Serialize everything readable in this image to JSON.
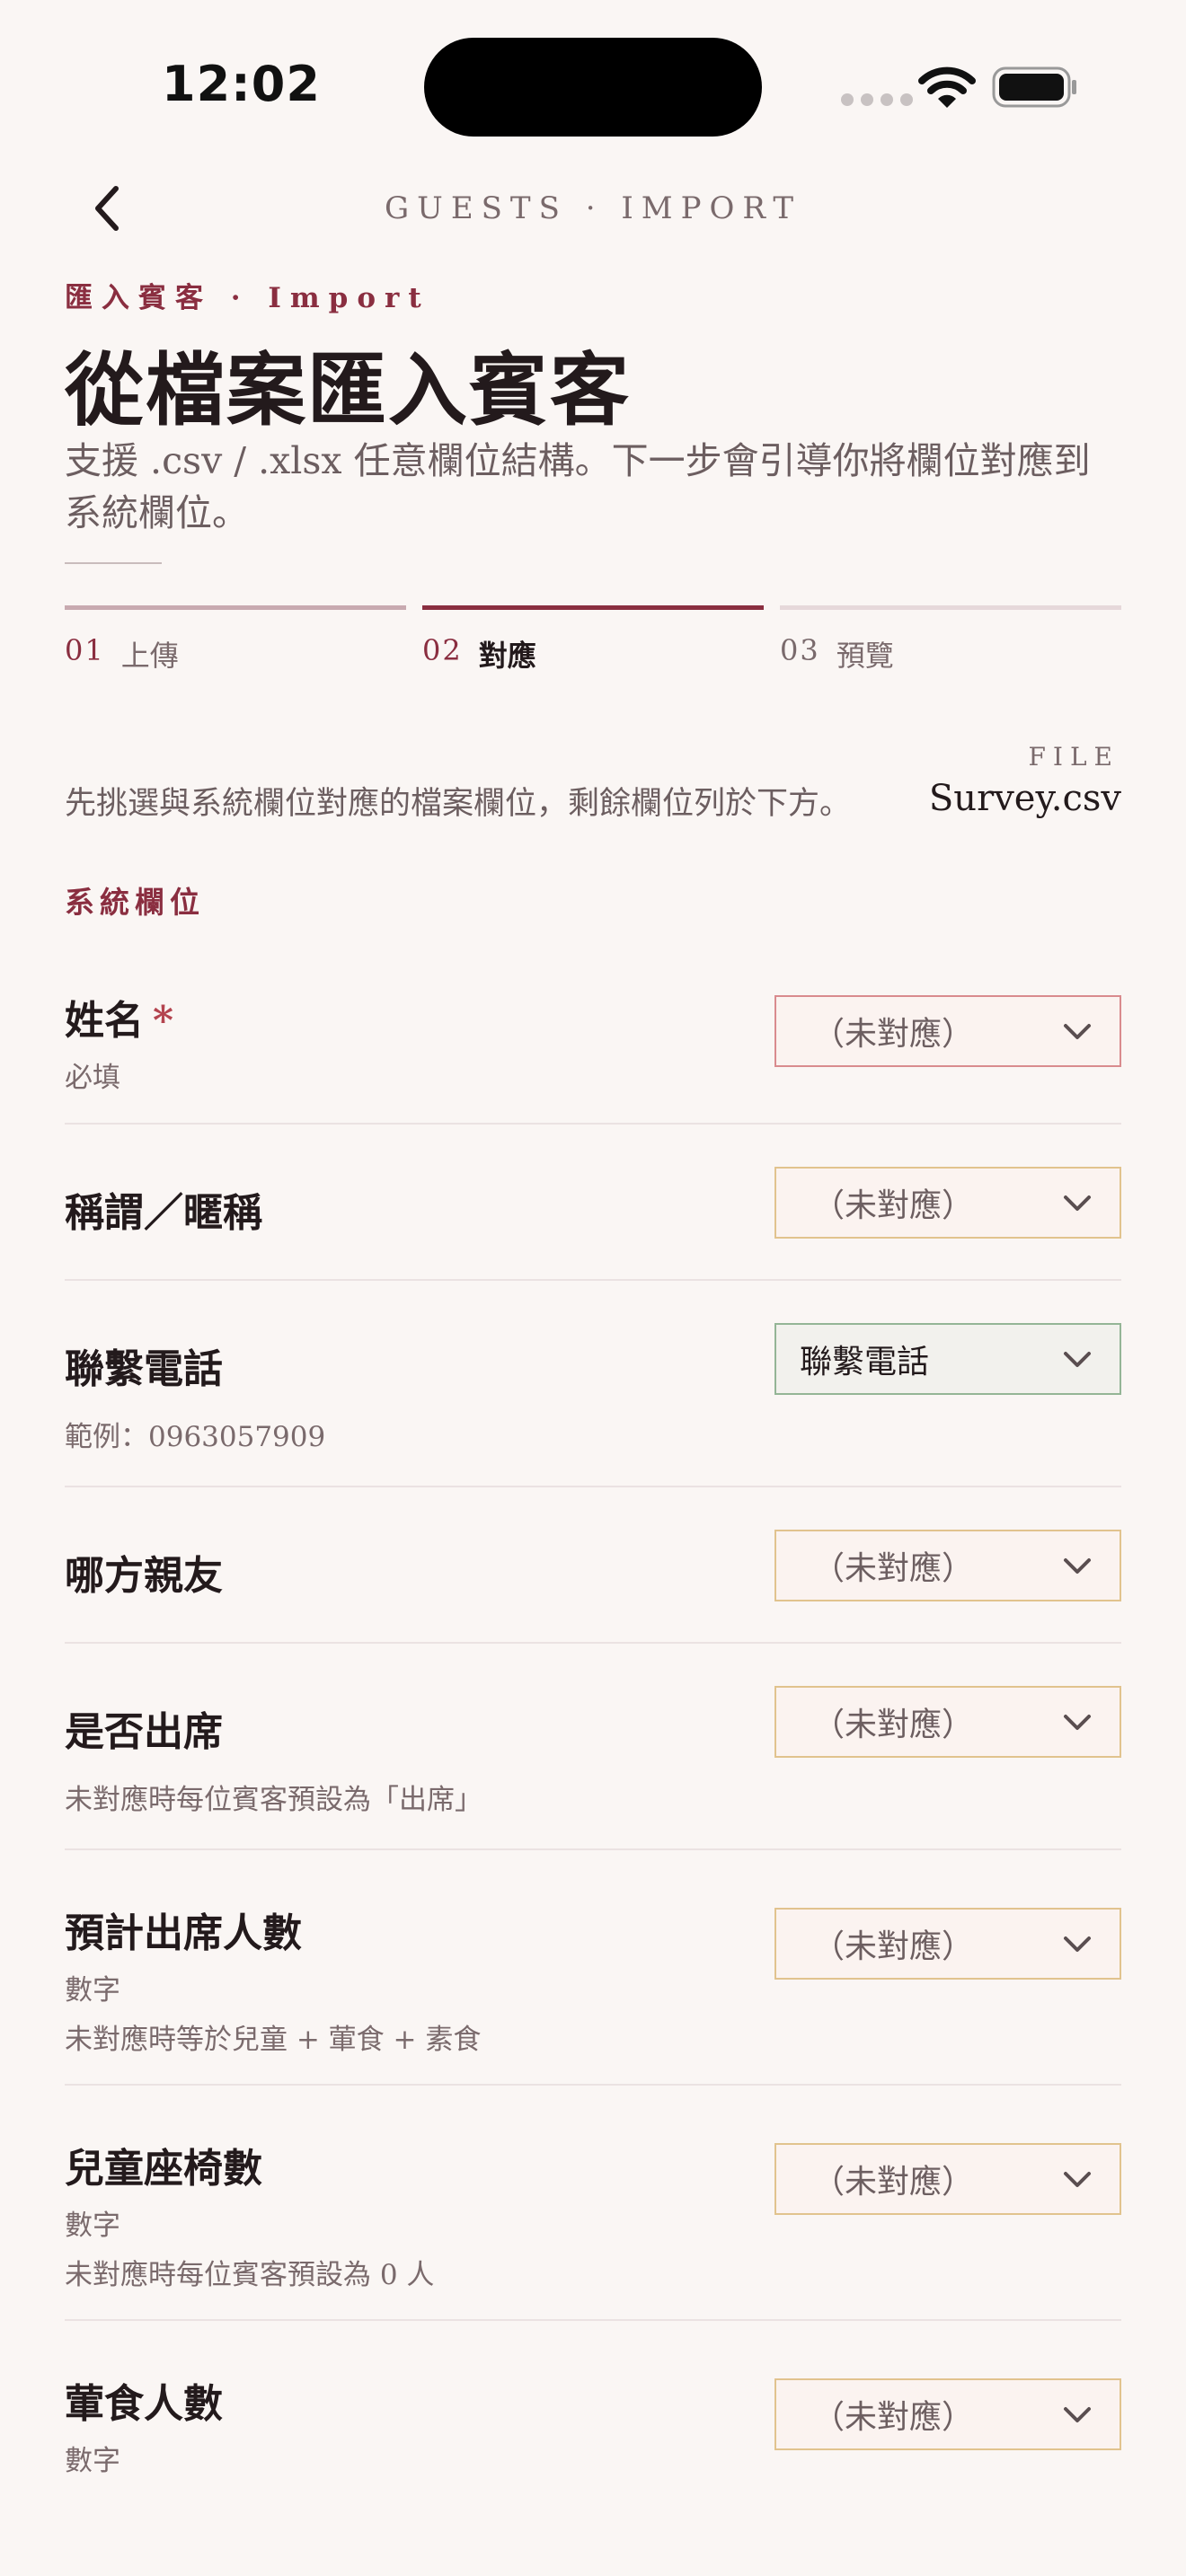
{
  "status_bar": {
    "time": "12:02"
  },
  "nav": {
    "title": "GUESTS · IMPORT"
  },
  "eyebrow": "匯入賓客 · Import",
  "title": "從檔案匯入賓客",
  "subtitle": "支援 .csv / .xlsx 任意欄位結構。下一步會引導你將欄位對應到系統欄位。",
  "steps": [
    {
      "num": "01",
      "label": "上傳",
      "state": "done"
    },
    {
      "num": "02",
      "label": "對應",
      "state": "active"
    },
    {
      "num": "03",
      "label": "預覽",
      "state": "pending"
    }
  ],
  "instruction": "先挑選與系統欄位對應的檔案欄位，剩餘欄位列於下方。",
  "file": {
    "label": "FILE",
    "name": "Survey.csv"
  },
  "section_label": "系統欄位",
  "fields": [
    {
      "name": "姓名",
      "required_mark": "*",
      "hints": [
        "必填"
      ],
      "value": "（未對應）"
    },
    {
      "name": "稱謂／暱稱",
      "hints": [],
      "value": "（未對應）"
    },
    {
      "name": "聯繫電話",
      "hints": [
        "範例：0963057909"
      ],
      "value": "聯繫電話"
    },
    {
      "name": "哪方親友",
      "hints": [],
      "value": "（未對應）"
    },
    {
      "name": "是否出席",
      "hints": [
        "未對應時每位賓客預設為「出席」"
      ],
      "value": "（未對應）"
    },
    {
      "name": "預計出席人數",
      "hints": [
        "數字",
        "未對應時等於兒童 + 葷食 + 素食"
      ],
      "value": "（未對應）"
    },
    {
      "name": "兒童座椅數",
      "hints": [
        "數字",
        "未對應時每位賓客預設為 0 人"
      ],
      "value": "（未對應）"
    },
    {
      "name": "葷食人數",
      "hints": [
        "數字"
      ],
      "value": "（未對應）"
    }
  ]
}
